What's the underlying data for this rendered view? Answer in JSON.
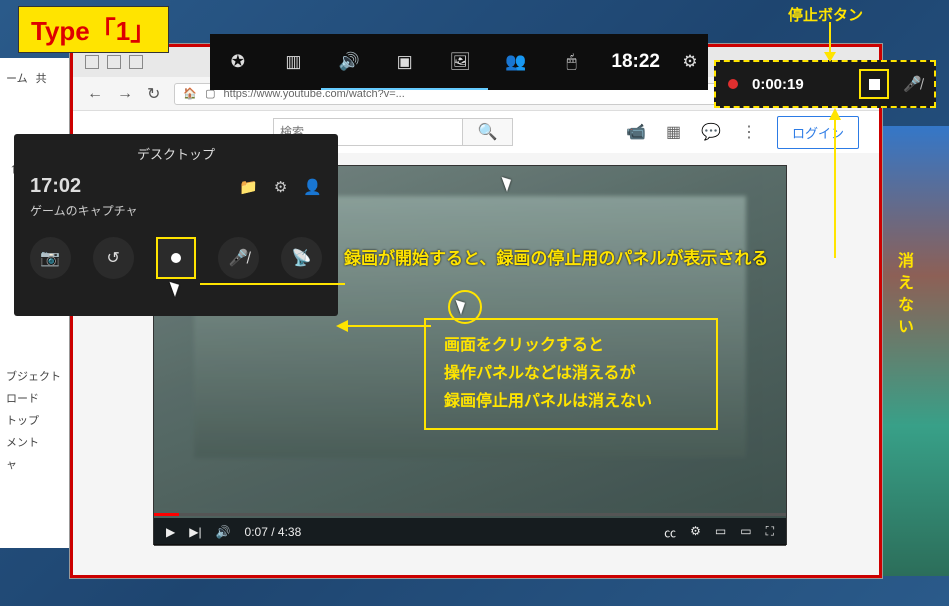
{
  "annotation": {
    "type_badge": "Type「1」",
    "stop_label": "停止ボタン",
    "right_vertical": "消えない",
    "note_start": "録画が開始すると、録画の停止用のパネルが表示される",
    "click_l1": "画面をクリックすると",
    "click_l2": "操作パネルなどは消えるが",
    "click_l3": "録画停止用パネルは消えない"
  },
  "left_panel": {
    "tab1": "ーム",
    "tab2": "共",
    "items": [
      "ブジェクト",
      "ロード",
      "トップ",
      "メント",
      "ャ"
    ]
  },
  "browser": {
    "url": "https://www.youtube.com/watch?v=...",
    "search_placeholder": "検索",
    "login": "ログイン"
  },
  "video": {
    "time": "0:07 / 4:38"
  },
  "xbar": {
    "clock": "18:22"
  },
  "recpanel": {
    "elapsed": "0:00:19"
  },
  "capture": {
    "title": "デスクトップ",
    "clock": "17:02",
    "sub": "ゲームのキャプチャ"
  }
}
